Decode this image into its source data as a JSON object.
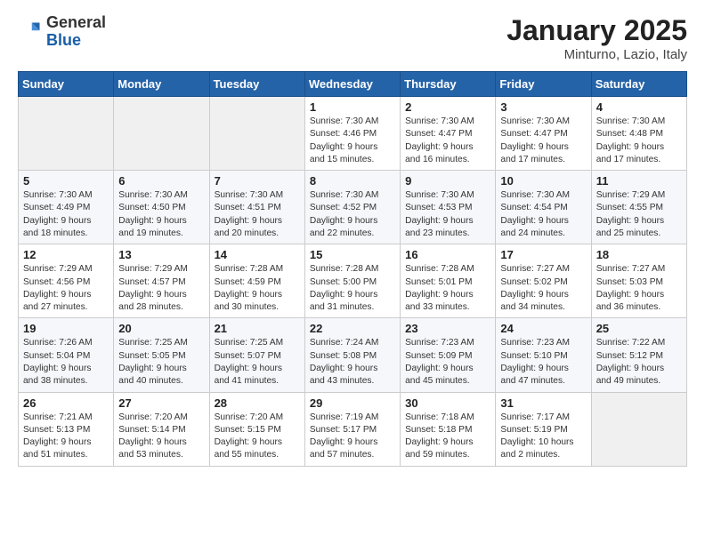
{
  "header": {
    "logo_general": "General",
    "logo_blue": "Blue",
    "title": "January 2025",
    "location": "Minturno, Lazio, Italy"
  },
  "days_of_week": [
    "Sunday",
    "Monday",
    "Tuesday",
    "Wednesday",
    "Thursday",
    "Friday",
    "Saturday"
  ],
  "weeks": [
    [
      {
        "day": "",
        "info": ""
      },
      {
        "day": "",
        "info": ""
      },
      {
        "day": "",
        "info": ""
      },
      {
        "day": "1",
        "info": "Sunrise: 7:30 AM\nSunset: 4:46 PM\nDaylight: 9 hours\nand 15 minutes."
      },
      {
        "day": "2",
        "info": "Sunrise: 7:30 AM\nSunset: 4:47 PM\nDaylight: 9 hours\nand 16 minutes."
      },
      {
        "day": "3",
        "info": "Sunrise: 7:30 AM\nSunset: 4:47 PM\nDaylight: 9 hours\nand 17 minutes."
      },
      {
        "day": "4",
        "info": "Sunrise: 7:30 AM\nSunset: 4:48 PM\nDaylight: 9 hours\nand 17 minutes."
      }
    ],
    [
      {
        "day": "5",
        "info": "Sunrise: 7:30 AM\nSunset: 4:49 PM\nDaylight: 9 hours\nand 18 minutes."
      },
      {
        "day": "6",
        "info": "Sunrise: 7:30 AM\nSunset: 4:50 PM\nDaylight: 9 hours\nand 19 minutes."
      },
      {
        "day": "7",
        "info": "Sunrise: 7:30 AM\nSunset: 4:51 PM\nDaylight: 9 hours\nand 20 minutes."
      },
      {
        "day": "8",
        "info": "Sunrise: 7:30 AM\nSunset: 4:52 PM\nDaylight: 9 hours\nand 22 minutes."
      },
      {
        "day": "9",
        "info": "Sunrise: 7:30 AM\nSunset: 4:53 PM\nDaylight: 9 hours\nand 23 minutes."
      },
      {
        "day": "10",
        "info": "Sunrise: 7:30 AM\nSunset: 4:54 PM\nDaylight: 9 hours\nand 24 minutes."
      },
      {
        "day": "11",
        "info": "Sunrise: 7:29 AM\nSunset: 4:55 PM\nDaylight: 9 hours\nand 25 minutes."
      }
    ],
    [
      {
        "day": "12",
        "info": "Sunrise: 7:29 AM\nSunset: 4:56 PM\nDaylight: 9 hours\nand 27 minutes."
      },
      {
        "day": "13",
        "info": "Sunrise: 7:29 AM\nSunset: 4:57 PM\nDaylight: 9 hours\nand 28 minutes."
      },
      {
        "day": "14",
        "info": "Sunrise: 7:28 AM\nSunset: 4:59 PM\nDaylight: 9 hours\nand 30 minutes."
      },
      {
        "day": "15",
        "info": "Sunrise: 7:28 AM\nSunset: 5:00 PM\nDaylight: 9 hours\nand 31 minutes."
      },
      {
        "day": "16",
        "info": "Sunrise: 7:28 AM\nSunset: 5:01 PM\nDaylight: 9 hours\nand 33 minutes."
      },
      {
        "day": "17",
        "info": "Sunrise: 7:27 AM\nSunset: 5:02 PM\nDaylight: 9 hours\nand 34 minutes."
      },
      {
        "day": "18",
        "info": "Sunrise: 7:27 AM\nSunset: 5:03 PM\nDaylight: 9 hours\nand 36 minutes."
      }
    ],
    [
      {
        "day": "19",
        "info": "Sunrise: 7:26 AM\nSunset: 5:04 PM\nDaylight: 9 hours\nand 38 minutes."
      },
      {
        "day": "20",
        "info": "Sunrise: 7:25 AM\nSunset: 5:05 PM\nDaylight: 9 hours\nand 40 minutes."
      },
      {
        "day": "21",
        "info": "Sunrise: 7:25 AM\nSunset: 5:07 PM\nDaylight: 9 hours\nand 41 minutes."
      },
      {
        "day": "22",
        "info": "Sunrise: 7:24 AM\nSunset: 5:08 PM\nDaylight: 9 hours\nand 43 minutes."
      },
      {
        "day": "23",
        "info": "Sunrise: 7:23 AM\nSunset: 5:09 PM\nDaylight: 9 hours\nand 45 minutes."
      },
      {
        "day": "24",
        "info": "Sunrise: 7:23 AM\nSunset: 5:10 PM\nDaylight: 9 hours\nand 47 minutes."
      },
      {
        "day": "25",
        "info": "Sunrise: 7:22 AM\nSunset: 5:12 PM\nDaylight: 9 hours\nand 49 minutes."
      }
    ],
    [
      {
        "day": "26",
        "info": "Sunrise: 7:21 AM\nSunset: 5:13 PM\nDaylight: 9 hours\nand 51 minutes."
      },
      {
        "day": "27",
        "info": "Sunrise: 7:20 AM\nSunset: 5:14 PM\nDaylight: 9 hours\nand 53 minutes."
      },
      {
        "day": "28",
        "info": "Sunrise: 7:20 AM\nSunset: 5:15 PM\nDaylight: 9 hours\nand 55 minutes."
      },
      {
        "day": "29",
        "info": "Sunrise: 7:19 AM\nSunset: 5:17 PM\nDaylight: 9 hours\nand 57 minutes."
      },
      {
        "day": "30",
        "info": "Sunrise: 7:18 AM\nSunset: 5:18 PM\nDaylight: 9 hours\nand 59 minutes."
      },
      {
        "day": "31",
        "info": "Sunrise: 7:17 AM\nSunset: 5:19 PM\nDaylight: 10 hours\nand 2 minutes."
      },
      {
        "day": "",
        "info": ""
      }
    ]
  ]
}
